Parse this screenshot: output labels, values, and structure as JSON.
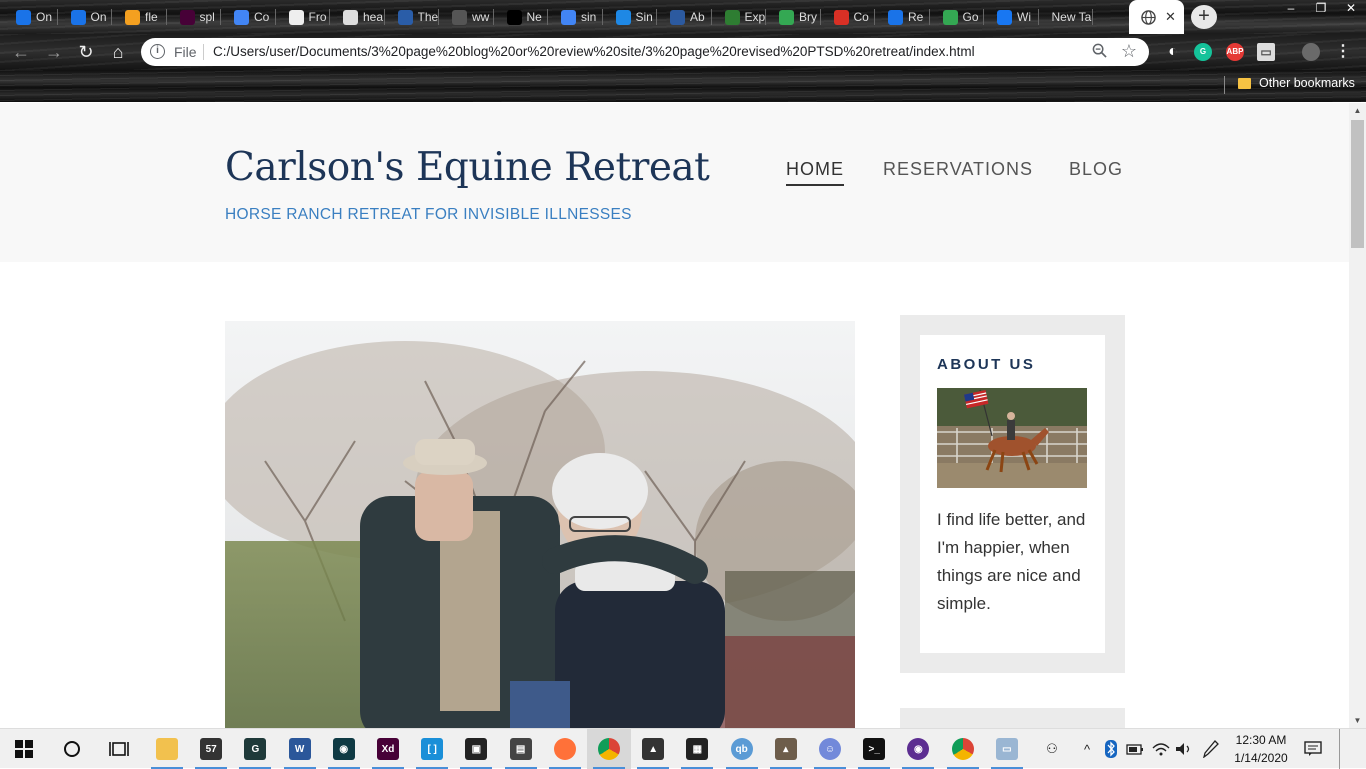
{
  "browser": {
    "tabs": [
      {
        "label": "On",
        "icon_color": "#1a73e8",
        "icon": "diamond-icon"
      },
      {
        "label": "On",
        "icon_color": "#1a73e8",
        "icon": "diamond-icon"
      },
      {
        "label": "fle",
        "icon_color": "#f4a020",
        "icon": "chart-icon"
      },
      {
        "label": "spl",
        "icon_color": "#470137",
        "icon": "xd-icon"
      },
      {
        "label": "Co",
        "icon_color": "#4285f4",
        "icon": "docs-icon"
      },
      {
        "label": "Fro",
        "icon_color": "#eeeeee",
        "icon": "page-icon"
      },
      {
        "label": "hea",
        "icon_color": "#dddddd",
        "icon": "globe-icon"
      },
      {
        "label": "The",
        "icon_color": "#2a5da8",
        "icon": "trend-icon"
      },
      {
        "label": "ww",
        "icon_color": "#555555",
        "icon": "blank-icon"
      },
      {
        "label": "Ne",
        "icon_color": "#000000",
        "icon": "rr-icon"
      },
      {
        "label": "sin",
        "icon_color": "#4285f4",
        "icon": "google-icon"
      },
      {
        "label": "Sin",
        "icon_color": "#1e88e5",
        "icon": "ae-icon"
      },
      {
        "label": "Ab",
        "icon_color": "#2c5aa0",
        "icon": "seal-icon"
      },
      {
        "label": "Exp",
        "icon_color": "#2e7d32",
        "icon": "globe-icon"
      },
      {
        "label": "Bry",
        "icon_color": "#34a853",
        "icon": "maps-icon"
      },
      {
        "label": "Co",
        "icon_color": "#d93025",
        "icon": "gmail-icon"
      },
      {
        "label": "Re",
        "icon_color": "#1a73e8",
        "icon": "house-icon"
      },
      {
        "label": "Go",
        "icon_color": "#34a853",
        "icon": "maps-icon"
      },
      {
        "label": "Wi",
        "icon_color": "#1877f2",
        "icon": "facebook-icon"
      },
      {
        "label": "New Ta",
        "icon_color": "#666666",
        "icon": "blank-icon"
      }
    ],
    "active_tab": {
      "label": "",
      "icon": "globe-icon"
    },
    "new_tab": "+",
    "window": {
      "minimize": "–",
      "restore": "❐",
      "close": "✕"
    },
    "nav": {
      "back": "←",
      "forward": "→",
      "reload": "↻",
      "home": "⌂"
    },
    "omnibox": {
      "scheme_label": "File",
      "url": "C:/Users/user/Documents/3%20page%20blog%20or%20review%20site/3%20page%20revised%20PTSD%20retreat/index.html"
    },
    "extensions": [
      {
        "name": "contrast-icon",
        "color": "#ffffff",
        "text": "◐"
      },
      {
        "name": "grammarly-icon",
        "color": "#15c39a",
        "text": "G"
      },
      {
        "name": "adblock-icon",
        "color": "#e53935",
        "text": "ABP"
      },
      {
        "name": "window-icon",
        "color": "#dddddd",
        "text": "▭"
      },
      {
        "name": "profile-avatar",
        "color": "#6a6a6a",
        "text": ""
      },
      {
        "name": "menu-icon",
        "color": "#eeeeee",
        "text": "⋮"
      }
    ],
    "bookmarks": {
      "other": "Other bookmarks"
    }
  },
  "site": {
    "title": "Carlson's Equine Retreat",
    "tagline": "HORSE RANCH RETREAT FOR INVISIBLE ILLNESSES",
    "nav": [
      "HOME",
      "RESERVATIONS",
      "BLOG"
    ],
    "sidebar": {
      "about_title": "ABOUT US",
      "about_text": "I find life better, and I'm happier, when things are nice and simple."
    }
  },
  "taskbar": {
    "apps": [
      {
        "name": "file-explorer-icon",
        "color": "#f2c14e",
        "text": ""
      },
      {
        "name": "mail-badge-icon",
        "color": "#333333",
        "text": "57"
      },
      {
        "name": "terminal-app-icon",
        "color": "#1f3a3a",
        "text": "G"
      },
      {
        "name": "word-icon",
        "color": "#2b579a",
        "text": "W"
      },
      {
        "name": "arduino-icon",
        "color": "#0f3a44",
        "text": "◉"
      },
      {
        "name": "xd-icon",
        "color": "#470137",
        "text": "Xd"
      },
      {
        "name": "brackets-icon",
        "color": "#1a8fd8",
        "text": "[ ]"
      },
      {
        "name": "color-app-icon",
        "color": "#222222",
        "text": "▣"
      },
      {
        "name": "office-icon",
        "color": "#444444",
        "text": "▤"
      },
      {
        "name": "firefox-icon",
        "color": "#ff7139",
        "text": ""
      },
      {
        "name": "chrome-icon",
        "color": "#db4437",
        "text": ""
      },
      {
        "name": "inkscape-icon",
        "color": "#333333",
        "text": "▲"
      },
      {
        "name": "calculator-icon",
        "color": "#222222",
        "text": "▦"
      },
      {
        "name": "qbittorrent-icon",
        "color": "#5b9bd5",
        "text": "qb"
      },
      {
        "name": "gimp-icon",
        "color": "#6d5d4b",
        "text": "▴"
      },
      {
        "name": "discord-icon",
        "color": "#7289da",
        "text": "☺"
      },
      {
        "name": "cmd-icon",
        "color": "#111111",
        "text": ">_"
      },
      {
        "name": "podcast-icon",
        "color": "#5c2d91",
        "text": "◉"
      },
      {
        "name": "chrome-icon-2",
        "color": "#db4437",
        "text": ""
      },
      {
        "name": "image-app-icon",
        "color": "#9ab6d3",
        "text": "▭"
      }
    ],
    "tray": {
      "people": "⚇",
      "chevron": "^",
      "time": "12:30 AM",
      "date": "1/14/2020"
    }
  }
}
